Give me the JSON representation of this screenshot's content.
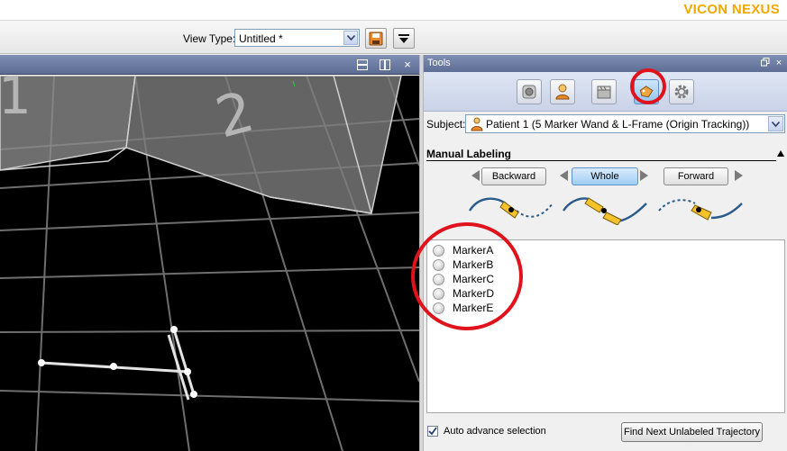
{
  "brand": "VICON NEXUS",
  "toolbar": {
    "view_type_label": "View Type:",
    "view_type_value": "Untitled *",
    "save_icon": "save-icon",
    "menu_icon": "dropdown-menu-icon"
  },
  "viewport": {
    "controls": [
      "split-horizontal-icon",
      "split-vertical-icon",
      "close-icon"
    ],
    "close_glyph": "×"
  },
  "tools": {
    "title": "Tools",
    "header_controls": [
      "restore-icon",
      "close-icon"
    ],
    "tabs": [
      {
        "icon": "camera-icon",
        "active": false
      },
      {
        "icon": "subject-icon",
        "active": false
      },
      {
        "icon": "clapperboard-icon",
        "active": false
      },
      {
        "icon": "label-tag-icon",
        "active": true
      },
      {
        "icon": "gear-icon",
        "active": false
      }
    ],
    "subject_label": "Subject:",
    "subject_value": "Patient 1 (5 Marker Wand & L-Frame (Origin Tracking))",
    "section_title": "Manual Labeling",
    "buttons": {
      "backward": "Backward",
      "whole": "Whole",
      "forward": "Forward"
    },
    "markers": [
      "MarkerA",
      "MarkerB",
      "MarkerC",
      "MarkerD",
      "MarkerE"
    ],
    "auto_advance_label": "Auto advance selection",
    "auto_advance_checked": true,
    "find_next_label": "Find Next Unlabeled Trajectory"
  },
  "colors": {
    "brand": "#f0a800",
    "annotation": "#e0121b",
    "header": "#6d7da3"
  }
}
